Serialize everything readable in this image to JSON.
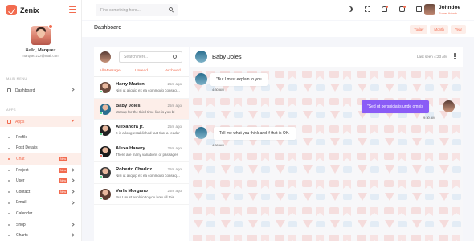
{
  "brand": {
    "name": "Zenix"
  },
  "header": {
    "search_placeholder": "Find something here...",
    "user_name": "Johndoe",
    "user_role": "Super Admin",
    "icons": [
      "moon-icon",
      "fullscreen-icon",
      "bell-icon",
      "chat-icon",
      "calendar-icon"
    ]
  },
  "profile": {
    "hello": "Hello,",
    "name": "Marquez",
    "email": "marquezzzz@mail.com"
  },
  "sidebar": {
    "main_menu_title": "MAIN MENU",
    "dashboard_label": "Dashboard",
    "apps_title": "APPS",
    "apps_label": "Apps",
    "sub_items": [
      {
        "label": "Profile",
        "badge": ""
      },
      {
        "label": "Post Details",
        "badge": ""
      },
      {
        "label": "Chat",
        "badge": "New"
      },
      {
        "label": "Project",
        "badge": "New"
      },
      {
        "label": "User",
        "badge": "New"
      },
      {
        "label": "Contact",
        "badge": "New"
      },
      {
        "label": "Email",
        "badge": ""
      },
      {
        "label": "Calendar",
        "badge": ""
      },
      {
        "label": "Shop",
        "badge": ""
      },
      {
        "label": "Charts",
        "badge": ""
      }
    ]
  },
  "titlebar": {
    "title": "Dashboard",
    "ranges": [
      "Today",
      "Month",
      "Year"
    ]
  },
  "chat_list": {
    "search_placeholder": "Search here..",
    "tabs": [
      "All Message",
      "Unread",
      "Archived"
    ],
    "items": [
      {
        "name": "Harry Marten",
        "time": "25m ago",
        "message": "Nisi ut aliquip ex ea commodo consequat",
        "status_color": "#2ecc71",
        "avatar_color": "#6b4a3d"
      },
      {
        "name": "Baby Joies",
        "time": "25m ago",
        "message": "Wasup for the third time like is you bl",
        "status_color": "#2ecc71",
        "avatar_color": "#2a6e8f"
      },
      {
        "name": "Alexandra jr.",
        "time": "25m ago",
        "message": "It is a long established fact that a reader",
        "status_color": "#2ecc71",
        "avatar_color": "#222222"
      },
      {
        "name": "Alexa Hanery",
        "time": "25m ago",
        "message": "There are many variations of passages",
        "status_color": "#e74c3c",
        "avatar_color": "#1a1a1a"
      },
      {
        "name": "Roberto Charloz",
        "time": "25m ago",
        "message": "Nisi ut aliquip ex ea commodo consequat",
        "status_color": "#2ecc71",
        "avatar_color": "#3a3a3a"
      },
      {
        "name": "Verla Morgano",
        "time": "25m ago",
        "message": "But I must explain to you how all this",
        "status_color": "#2ecc71",
        "avatar_color": "#5b3b30"
      }
    ]
  },
  "chat_panel": {
    "name": "Baby Joies",
    "last_seen": "Last seen 4:23 AM",
    "messages": [
      {
        "text": "\"But I must explain to you",
        "time": "4:30 AM",
        "direction": "in"
      },
      {
        "text": "\"Sed ut perspiciatis unde omnis",
        "time": "9:30 AM",
        "direction": "out"
      },
      {
        "text": "Tell me what you think and if that is OK.",
        "time": "4:30 AM",
        "direction": "in"
      }
    ]
  },
  "colors": {
    "accent": "#f26b4f",
    "accent_soft": "#fdeee9",
    "outgoing_bubble": "#8a5cf6"
  }
}
